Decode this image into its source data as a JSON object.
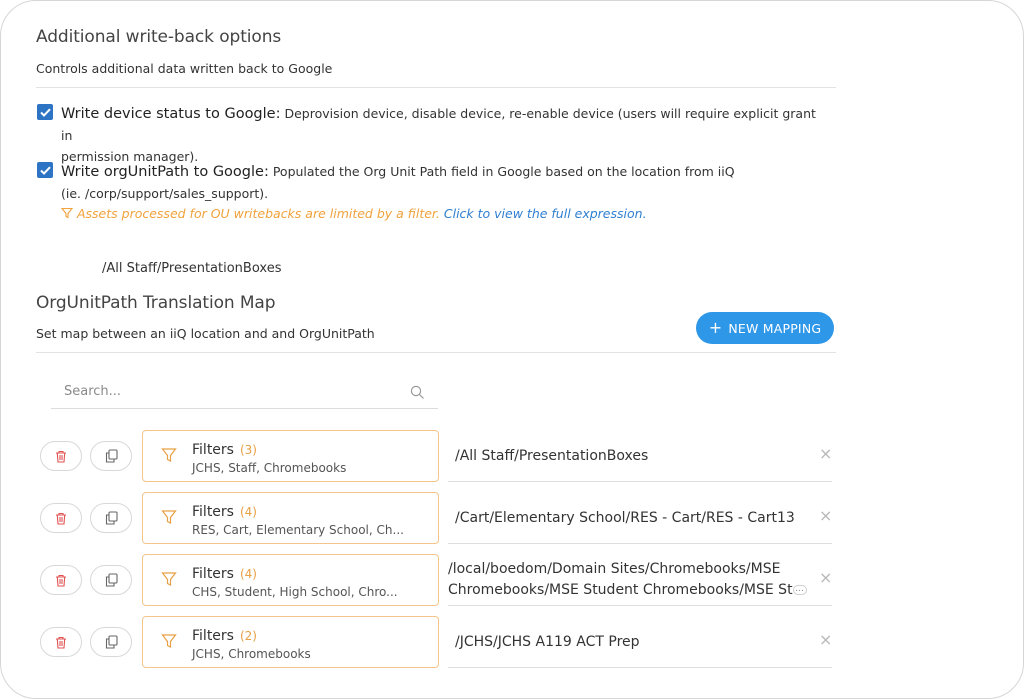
{
  "writeback": {
    "title": "Additional write-back options",
    "subtitle": "Controls additional data written back to Google",
    "options": [
      {
        "title": "Write device status to Google:",
        "description": "Deprovision device, disable device, re-enable device (users will require explicit grant in",
        "description_cont": "permission manager).",
        "checked": true
      },
      {
        "title": "Write orgUnitPath to Google:",
        "description": "Populated the Org Unit Path field in Google based on the location from iiQ",
        "description_cont": "(ie. /corp/support/sales_support).",
        "checked": true
      }
    ],
    "warning_text": "Assets processed for OU writebacks are limited by a filter.",
    "warning_link": "Click to view the full expression",
    "warning_period": "."
  },
  "floating_path": "/All Staff/PresentationBoxes",
  "translation_map": {
    "title": "OrgUnitPath Translation Map",
    "subtitle": "Set map between an iiQ location and and OrgUnitPath",
    "new_button": "NEW MAPPING",
    "search_placeholder": "Search..."
  },
  "mappings": [
    {
      "filter_label": "Filters",
      "count": "(3)",
      "tags": "JCHS, Staff, Chromebooks",
      "path": "/All Staff/PresentationBoxes",
      "path_cont": ""
    },
    {
      "filter_label": "Filters",
      "count": "(4)",
      "tags": "RES, Cart, Elementary School, Ch...",
      "path": "/Cart/Elementary School/RES - Cart/RES - Cart13",
      "path_cont": ""
    },
    {
      "filter_label": "Filters",
      "count": "(4)",
      "tags": "CHS, Student, High School, Chro...",
      "path": "/local/boedom/Domain Sites/Chromebooks/MSE",
      "path_cont": "Chromebooks/MSE Student Chromebooks/MSE St"
    },
    {
      "filter_label": "Filters",
      "count": "(2)",
      "tags": "JCHS, Chromebooks",
      "path": "/JCHS/JCHS A119 ACT Prep",
      "path_cont": ""
    }
  ],
  "colors": {
    "accent": "#2f97e8",
    "checkbox": "#2e74c4",
    "warning": "#f0a23c",
    "link": "#2f7fd0",
    "delete": "#e05252"
  }
}
